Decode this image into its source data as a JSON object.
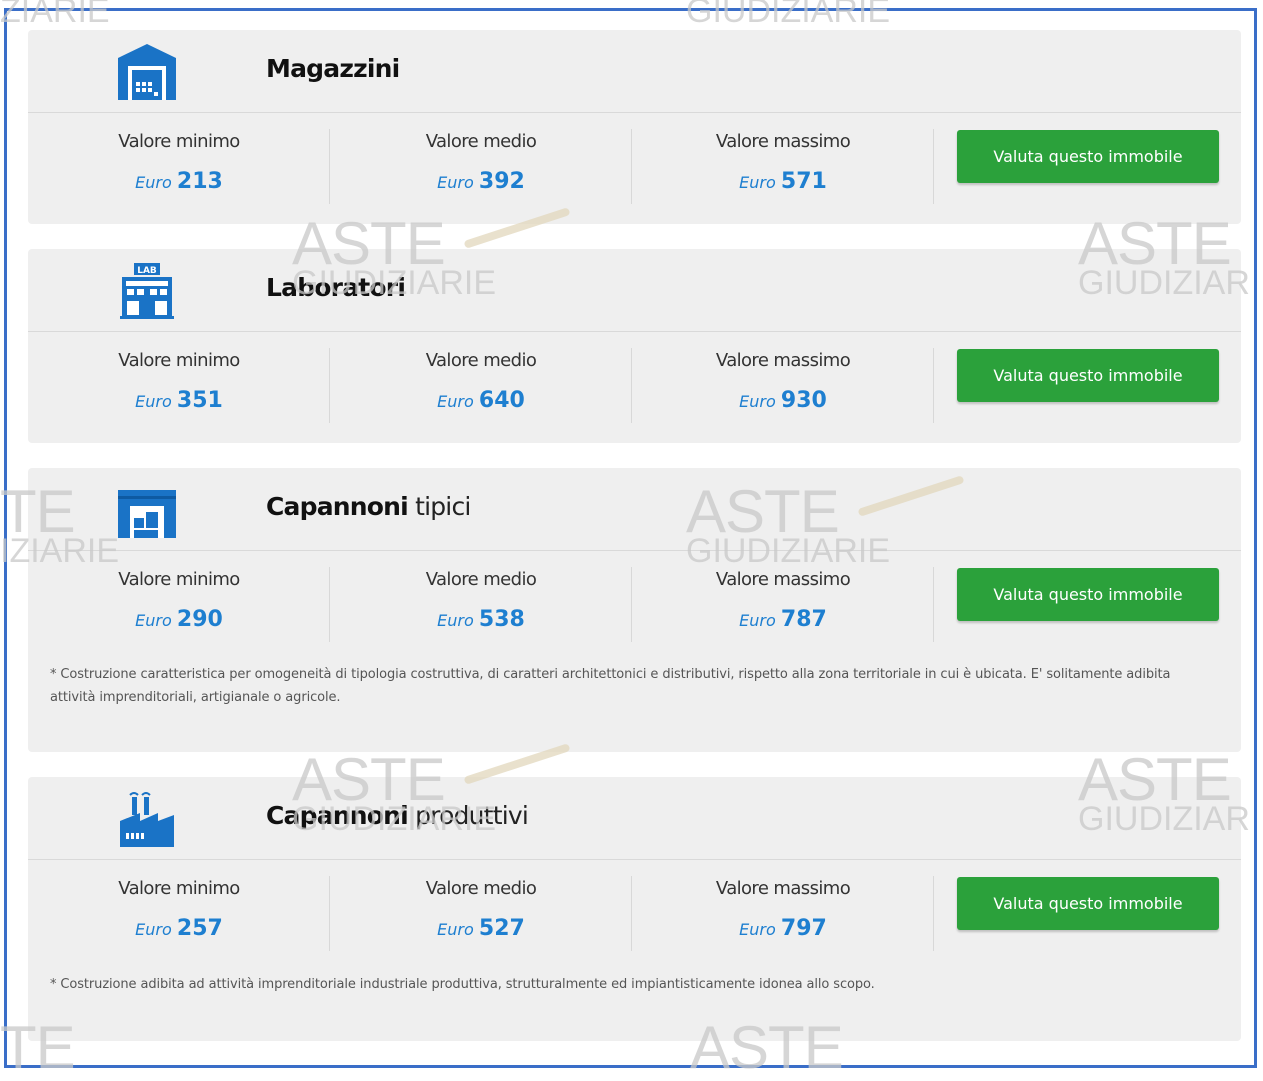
{
  "labels": {
    "min": "Valore minimo",
    "avg": "Valore medio",
    "max": "Valore massimo",
    "currency": "Euro",
    "button": "Valuta questo immobile"
  },
  "watermark": {
    "line1": "ASTE",
    "line2": "GIUDIZIARIE",
    "partial1": "ZIARIE",
    "partial2": "ASTE",
    "partial3": "GIUDIZIAR",
    "partial4": "TE",
    "partial5": "IZIARIE"
  },
  "cards": [
    {
      "title_bold": "Magazzini",
      "title_light": "",
      "icon": "warehouse-icon",
      "min": "213",
      "avg": "392",
      "max": "571",
      "note": ""
    },
    {
      "title_bold": "Laboratori",
      "title_light": "",
      "icon": "laboratory-building-icon",
      "min": "351",
      "avg": "640",
      "max": "930",
      "note": ""
    },
    {
      "title_bold": "Capannoni",
      "title_light": "tipici",
      "icon": "shed-icon",
      "min": "290",
      "avg": "538",
      "max": "787",
      "note": "* Costruzione caratteristica per omogeneità di tipologia costruttiva, di caratteri architettonici e distributivi, rispetto alla zona territoriale in cui è ubicata. E' solitamente adibita attività imprenditoriali, artigianale o agricole."
    },
    {
      "title_bold": "Capannoni",
      "title_light": "produttivi",
      "icon": "factory-icon",
      "min": "257",
      "avg": "527",
      "max": "797",
      "note": "* Costruzione adibita ad attività imprenditoriale industriale produttiva, strutturalmente ed impiantisticamente idonea allo scopo."
    }
  ],
  "colors": {
    "accent_blue": "#1e7fd0",
    "button_green": "#2ba13b",
    "icon_blue": "#1a73c6",
    "frame": "#3a6ec8"
  }
}
